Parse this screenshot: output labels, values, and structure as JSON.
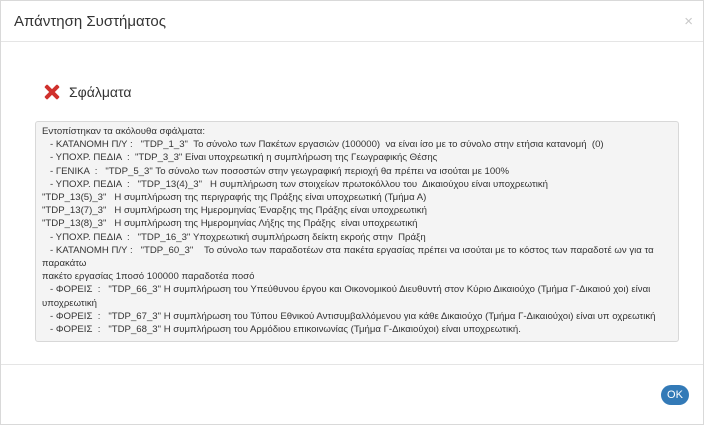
{
  "dialog": {
    "title": "Απάντηση Συστήματος",
    "close_label": "×"
  },
  "errors": {
    "heading": "Σφάλματα",
    "icon": "error-x-icon",
    "lines": [
      "Εντοπίστηκαν τα ακόλουθα σφάλματα:",
      "   - ΚΑΤΑΝΟΜΗ Π/Υ :   \"TDP_1_3\"  Το σύνολο των Πακέτων εργασιών (100000)  να είναι ίσο με το σύνολο στην ετήσια κατανομή  (0)",
      "   - ΥΠΟΧΡ. ΠΕΔΙΑ  :  \"TDP_3_3\" Είναι υποχρεωτική η συμπλήρωση της Γεωγραφικής Θέσης",
      "   - ΓΕΝΙΚΑ  :   \"TDP_5_3\" Το σύνολο των ποσοστών στην γεωγραφική περιοχή θα πρέπει να ισούται με 100%",
      "   - ΥΠΟΧΡ. ΠΕΔΙΑ  :   \"TDP_13(4)_3\"   Η συμπλήρωση των στοιχείων πρωτοκόλλου του  Δικαιούχου είναι υποχρεωτική",
      "\"TDP_13(5)_3\"   Η συμπλήρωση της περιγραφής της Πράξης είναι υποχρεωτική (Τμήμα Α)",
      "\"TDP_13(7)_3\"   Η συμπλήρωση της Ημερομηνίας Έναρξης της Πράξης είναι υποχρεωτική",
      "\"TDP_13(8)_3\"   Η συμπλήρωση της Ημερομηνίας Λήξης της Πράξης  είναι υποχρεωτική",
      "   - ΥΠΟΧΡ. ΠΕΔΙΑ  :   \"TDP_16_3\" Υποχρεωτική συμπλήρωση δείκτη εκροής στην  Πράξη",
      "   - ΚΑΤΑΝΟΜΗ Π/Υ :   \"TDP_60_3\"    Το σύνολο των παραδοτέων στα πακέτα εργασίας πρέπει να ισούται με το κόστος των παραδοτέ ων για τα παρακάτω",
      "πακέτο εργασίας 1ποσό 100000 παραδοτέα ποσό",
      "   - ΦΟΡΕΙΣ  :   \"TDP_66_3\" Η συμπλήρωση του Υπεύθυνου έργου και Οικονομικού Διευθυντή στον Κύριο Δικαιούχο (Τμήμα Γ-Δικαιού χοι) είναι υποχρεωτική",
      "   - ΦΟΡΕΙΣ  :   \"TDP_67_3\" Η συμπλήρωση του Τύπου Εθνικού Αντισυμβαλλόμενου για κάθε Δικαιούχο (Τμήμα Γ-Δικαιούχοι) είναι υπ οχρεωτική",
      "   - ΦΟΡΕΙΣ  :   \"TDP_68_3\" Η συμπλήρωση του Αρμόδιου επικοινωνίας (Τμήμα Γ-Δικαιούχοι) είναι υποχρεωτική."
    ]
  },
  "footer": {
    "ok_label": "OK"
  },
  "colors": {
    "error_icon": "#d0312d",
    "ok_button": "#337ab7",
    "message_box_bg": "#f4f4f4"
  }
}
